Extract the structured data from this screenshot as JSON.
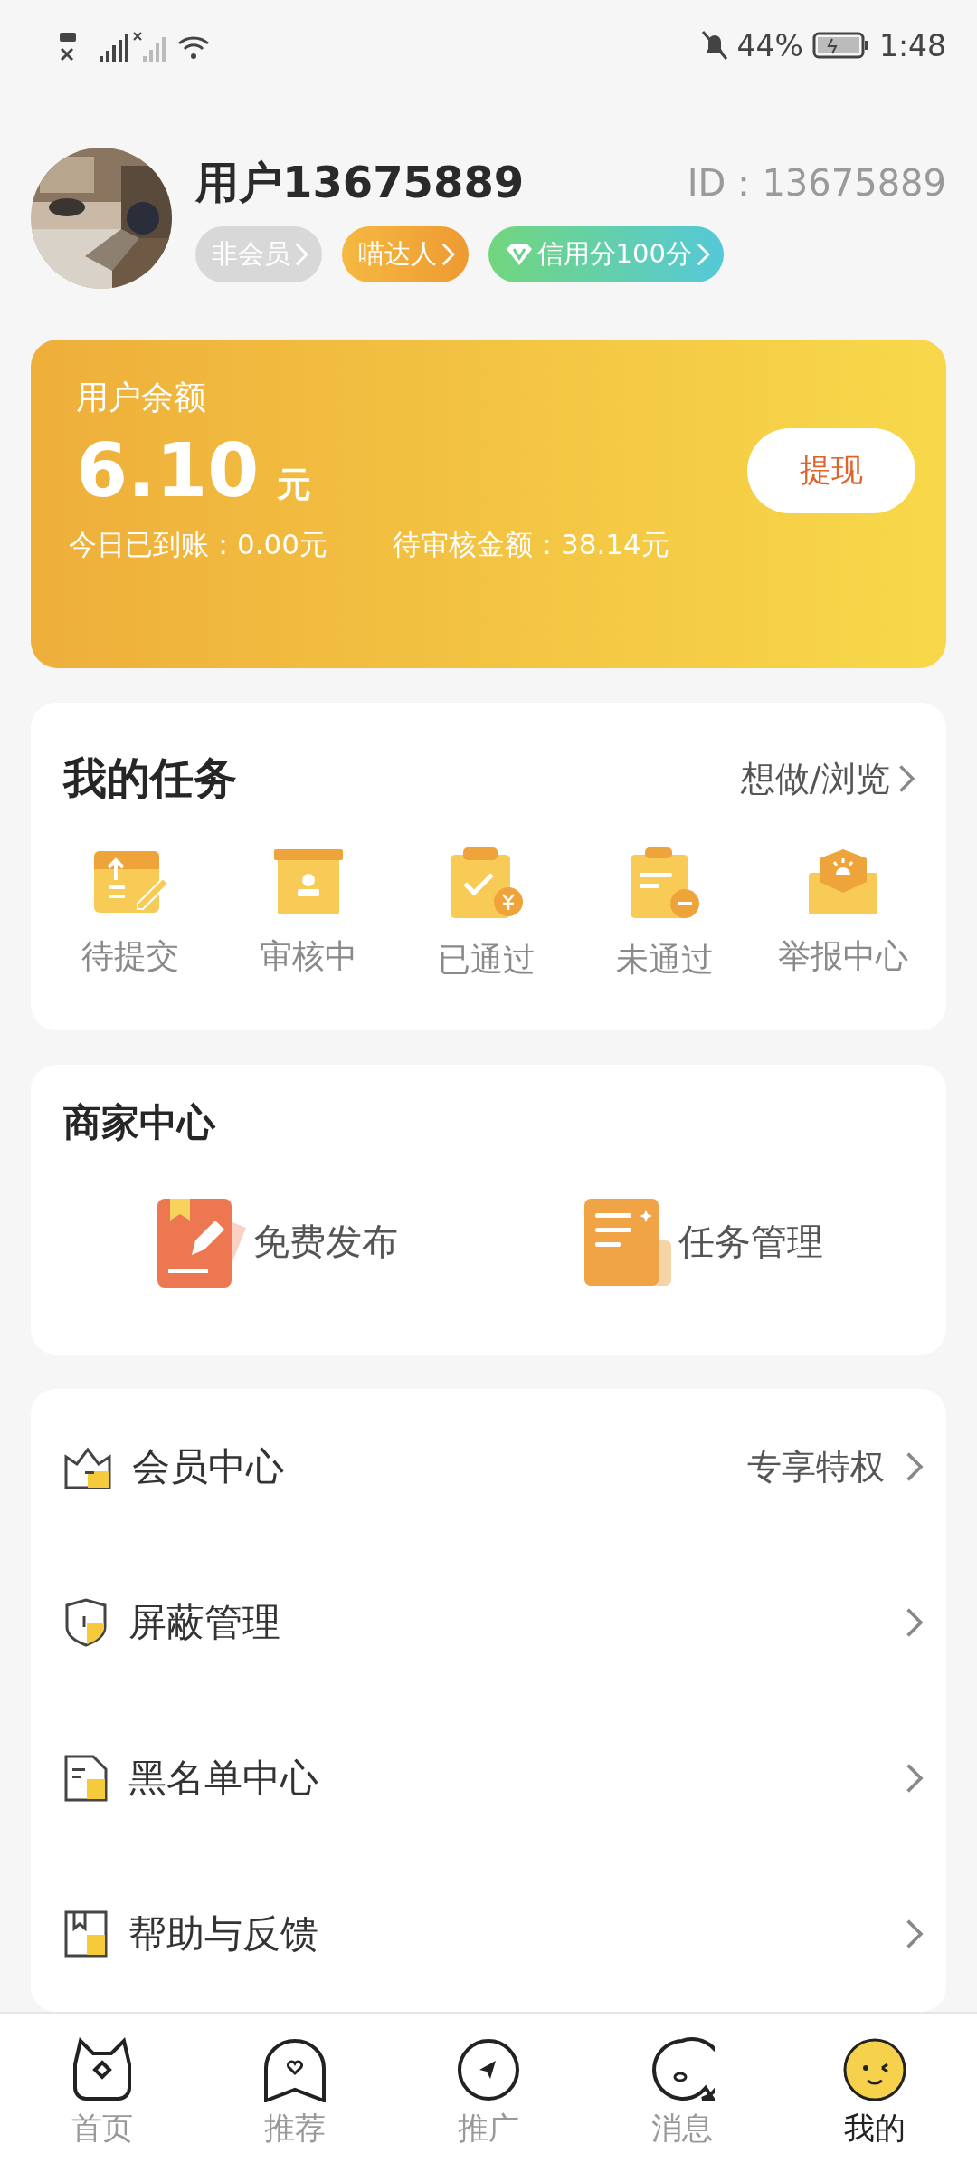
{
  "status_bar": {
    "battery": "44%",
    "time": "1:48"
  },
  "profile": {
    "name": "用户13675889",
    "id_label": "ID：",
    "id_value": "13675889",
    "badges": [
      {
        "kind": "status",
        "label": "非会员"
      },
      {
        "kind": "level",
        "label": "喵达人"
      },
      {
        "kind": "credit",
        "label": "信用分100分"
      }
    ]
  },
  "balance": {
    "title": "用户余额",
    "amount": "6.10",
    "unit": "元",
    "button": "提现",
    "today": "今日已到账：0.00元",
    "pending": "待审核金额：38.14元"
  },
  "tasks": {
    "title": "我的任务",
    "link": "想做/浏览",
    "items": [
      {
        "label": "待提交"
      },
      {
        "label": "审核中"
      },
      {
        "label": "已通过"
      },
      {
        "label": "未通过"
      },
      {
        "label": "举报中心"
      }
    ]
  },
  "merchant": {
    "title": "商家中心",
    "items": [
      {
        "label": "免费发布"
      },
      {
        "label": "任务管理"
      }
    ]
  },
  "menu": [
    {
      "label": "会员中心",
      "hint": "专享特权"
    },
    {
      "label": "屏蔽管理"
    },
    {
      "label": "黑名单中心"
    },
    {
      "label": "帮助与反馈"
    }
  ],
  "tabs": [
    {
      "label": "首页",
      "selected": false
    },
    {
      "label": "推荐",
      "selected": false
    },
    {
      "label": "推广",
      "selected": false
    },
    {
      "label": "消息",
      "selected": false
    },
    {
      "label": "我的",
      "selected": true
    }
  ]
}
